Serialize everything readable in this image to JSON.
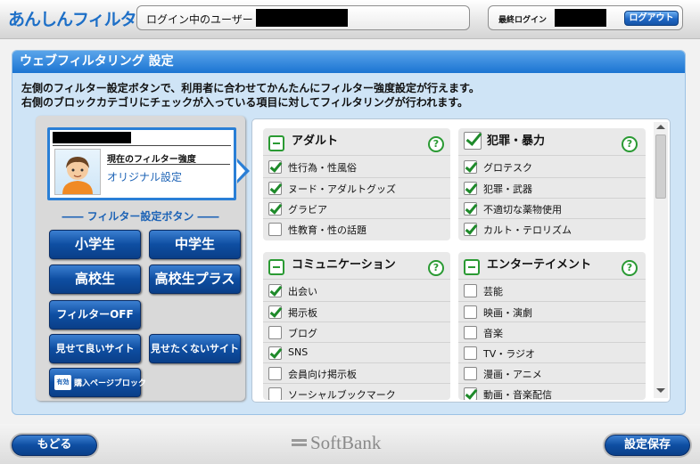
{
  "header": {
    "brand": "あんしんフィルター",
    "user_label": "ログイン中のユーザー",
    "last_login_label": "最終ログイン",
    "logout_label": "ログアウト"
  },
  "panel": {
    "title": "ウェブフィルタリング 設定",
    "desc1": "左側のフィルター設定ボタンで、利用者に合わせてかんたんにフィルター強度設定が行えます。",
    "desc2": "右側のブロックカテゴリにチェックが入っている項目に対してフィルタリングが行われます。"
  },
  "profile": {
    "strength_label": "現在のフィルター強度",
    "strength_value": "オリジナル設定"
  },
  "filter_buttons": {
    "header": "―― フィルター設定ボタン ――",
    "elementary": "小学生",
    "junior_high": "中学生",
    "high_school": "高校生",
    "high_school_plus": "高校生プラス",
    "filter_off": "フィルターOFF",
    "allowed_sites": "見せて良いサイト",
    "blocked_sites": "見せたくないサイト",
    "purchase_block_badge": "有効",
    "purchase_block": "購入ページブロック"
  },
  "categories": {
    "adult": {
      "name": "アダルト",
      "items": [
        {
          "label": "性行為・性風俗",
          "checked": true
        },
        {
          "label": "ヌード・アダルトグッズ",
          "checked": true
        },
        {
          "label": "グラビア",
          "checked": true
        },
        {
          "label": "性教育・性の話題",
          "checked": false
        }
      ]
    },
    "crime": {
      "name": "犯罪・暴力",
      "items": [
        {
          "label": "グロテスク",
          "checked": true
        },
        {
          "label": "犯罪・武器",
          "checked": true
        },
        {
          "label": "不適切な薬物使用",
          "checked": true
        },
        {
          "label": "カルト・テロリズム",
          "checked": true
        }
      ]
    },
    "communication": {
      "name": "コミュニケーション",
      "items": [
        {
          "label": "出会い",
          "checked": true
        },
        {
          "label": "掲示板",
          "checked": true
        },
        {
          "label": "ブログ",
          "checked": false
        },
        {
          "label": "SNS",
          "checked": true
        },
        {
          "label": "会員向け掲示板",
          "checked": false
        },
        {
          "label": "ソーシャルブックマーク",
          "checked": false
        }
      ]
    },
    "entertainment": {
      "name": "エンターテイメント",
      "items": [
        {
          "label": "芸能",
          "checked": false
        },
        {
          "label": "映画・演劇",
          "checked": false
        },
        {
          "label": "音楽",
          "checked": false
        },
        {
          "label": "TV・ラジオ",
          "checked": false
        },
        {
          "label": "漫画・アニメ",
          "checked": false
        },
        {
          "label": "動画・音楽配信",
          "checked": true
        }
      ]
    },
    "help_symbol": "?"
  },
  "footer": {
    "back_label": "もどる",
    "save_label": "設定保存",
    "logo_text": "SoftBank"
  }
}
